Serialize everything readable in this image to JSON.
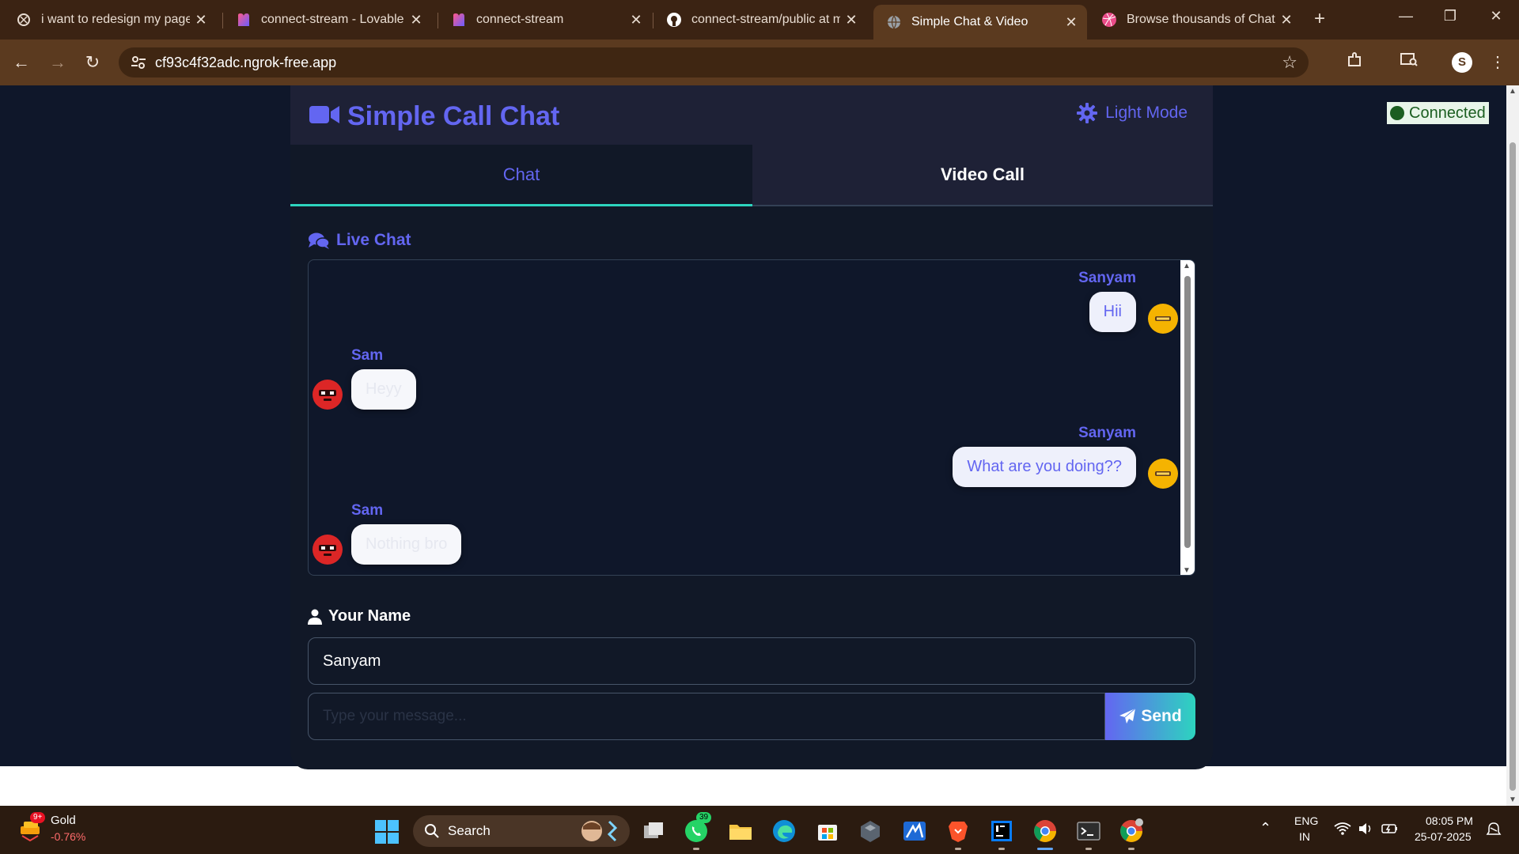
{
  "browser": {
    "tabs": [
      {
        "title": "i want to redesign my page",
        "icon": "notion-icon"
      },
      {
        "title": "connect-stream - Lovable",
        "icon": "lovable-icon"
      },
      {
        "title": "connect-stream",
        "icon": "lovable-icon"
      },
      {
        "title": "connect-stream/public at m",
        "icon": "github-icon"
      },
      {
        "title": "Simple Chat & Video",
        "icon": "globe-icon",
        "active": true
      },
      {
        "title": "Browse thousands of Chat /",
        "icon": "dribbble-icon"
      }
    ],
    "url": "cf93c4f32adc.ngrok-free.app",
    "profile_initial": "S"
  },
  "app": {
    "title": "Simple Call Chat",
    "theme_toggle": "Light Mode",
    "tabs": {
      "chat": "Chat",
      "video": "Video Call"
    },
    "chat_section_title": "Live Chat",
    "messages": [
      {
        "sender": "Sanyam",
        "text": "Hii",
        "side": "right"
      },
      {
        "sender": "Sam",
        "text": "Heyy",
        "side": "left"
      },
      {
        "sender": "Sanyam",
        "text": "What are you doing??",
        "side": "right"
      },
      {
        "sender": "Sam",
        "text": "Nothing bro",
        "side": "left"
      }
    ],
    "name_label": "Your Name",
    "name_value": "Sanyam",
    "message_placeholder": "Type your message...",
    "send_label": "Send",
    "status": "Connected"
  },
  "taskbar": {
    "weather_badge": "9+",
    "ticker_name": "Gold",
    "ticker_change": "-0.76%",
    "search_label": "Search",
    "whatsapp_badge": "39",
    "lang": "ENG",
    "region": "IN",
    "time": "08:05 PM",
    "date": "25-07-2025"
  },
  "colors": {
    "accent": "#6366f1",
    "teal": "#2dd4bf",
    "page_bg": "#0f172a",
    "panel_bg": "#111827",
    "header_bg": "#1e2136",
    "browser_frame": "#5b3a1f"
  }
}
